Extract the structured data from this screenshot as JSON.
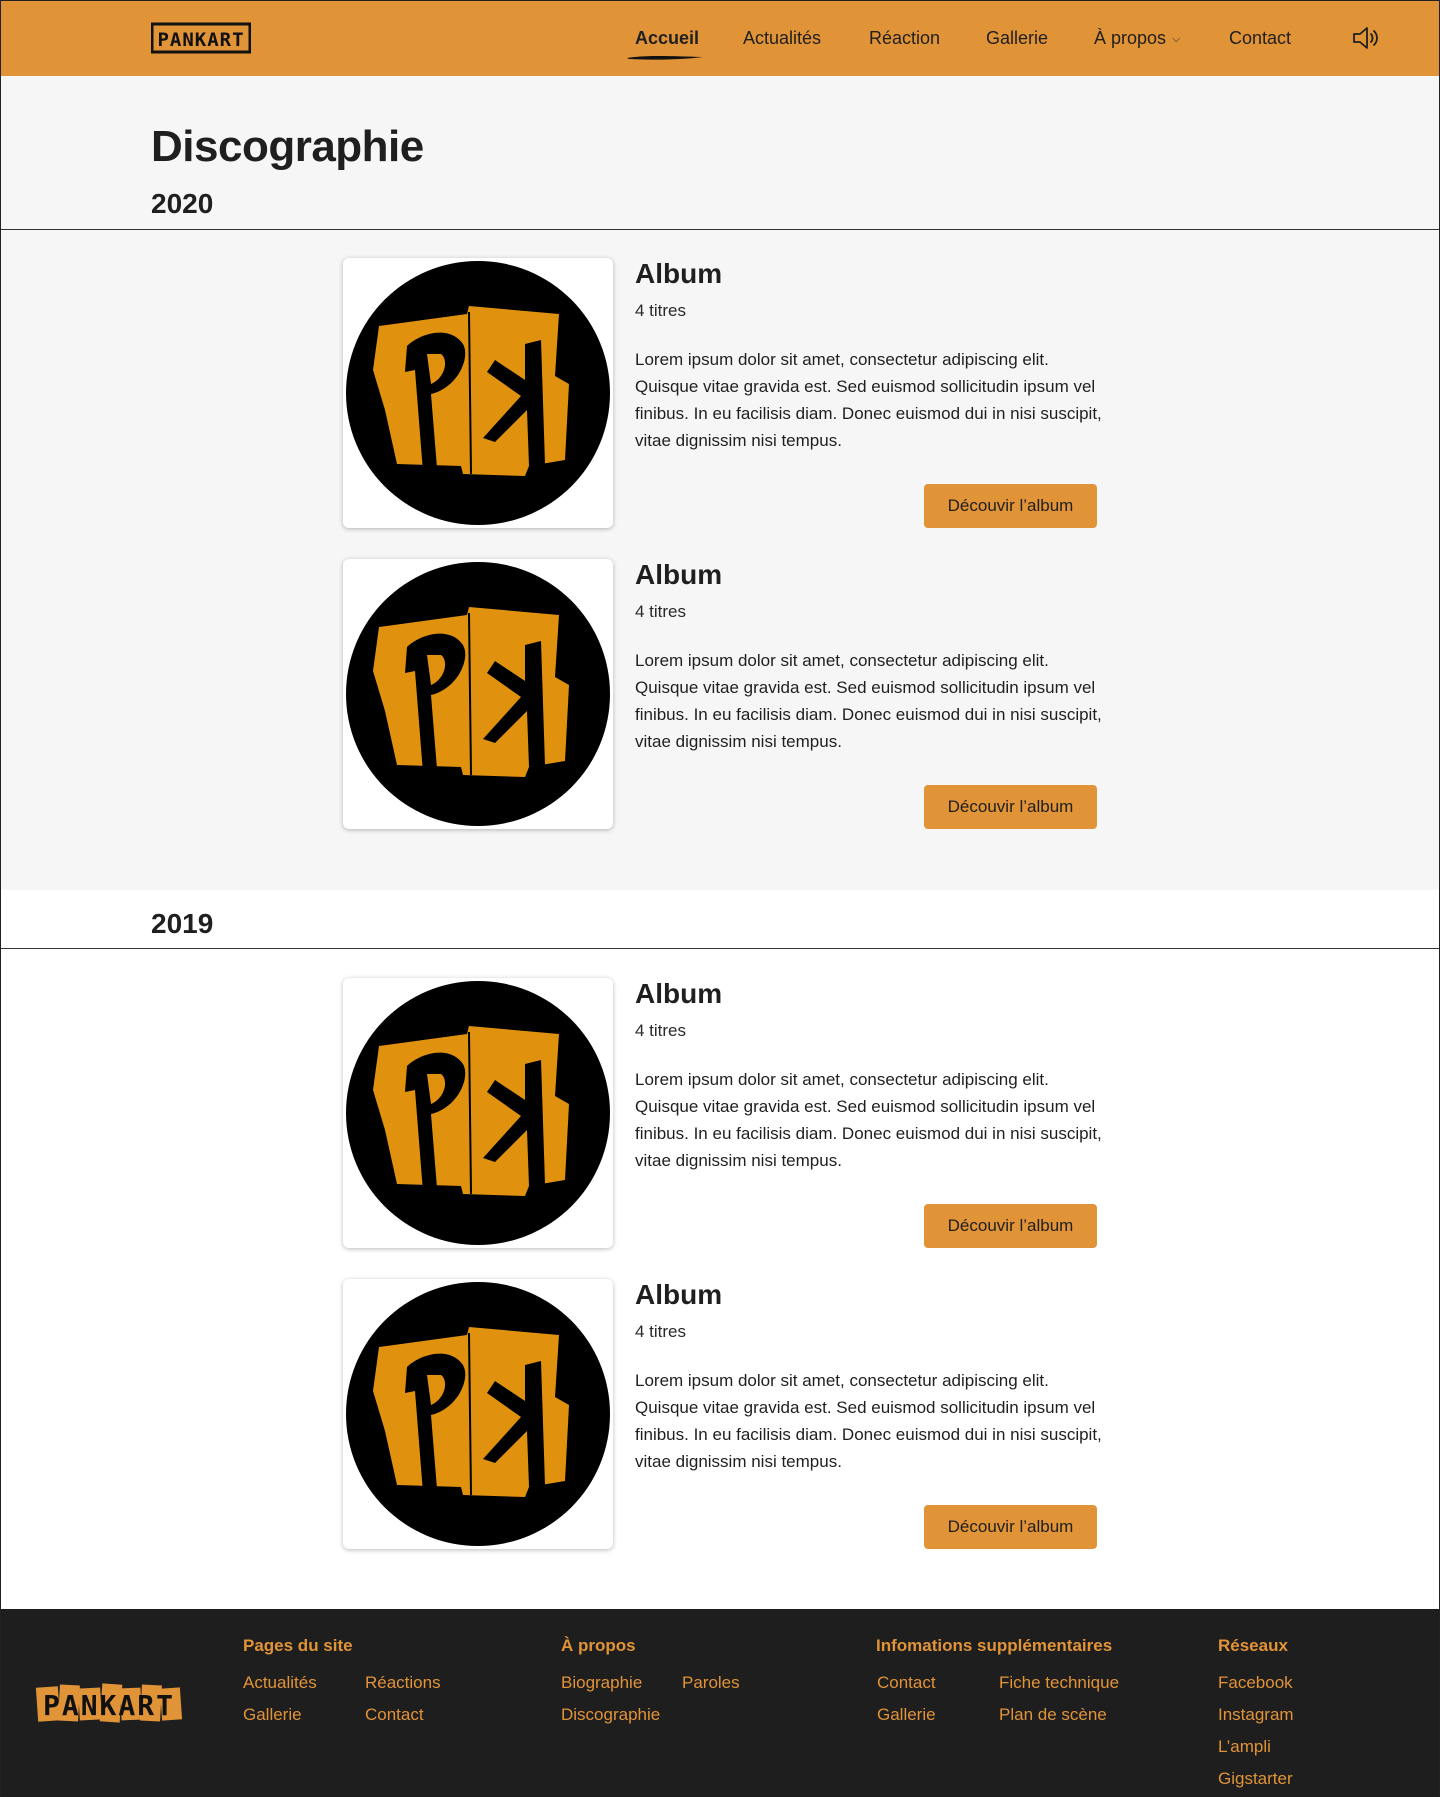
{
  "brand": {
    "logo_text": "PANKART",
    "accent_color": "#e19338",
    "dark_color": "#1e1e1e"
  },
  "nav": {
    "items": [
      {
        "label": "Accueil",
        "active": true
      },
      {
        "label": "Actualités"
      },
      {
        "label": "Réaction"
      },
      {
        "label": "Gallerie"
      },
      {
        "label": "À propos",
        "has_dropdown": true,
        "chevron": "⌵"
      },
      {
        "label": "Contact"
      }
    ],
    "sound_icon": "speaker-icon"
  },
  "page": {
    "title": "Discographie"
  },
  "sections": [
    {
      "year": "2020",
      "albums": [
        {
          "title": "Album",
          "count": "4 titres",
          "description": "Lorem ipsum dolor sit amet, consectetur adipiscing elit. Quisque vitae gravida est. Sed euismod sollicitudin ipsum vel finibus. In eu facilisis diam. Donec euismod dui in nisi suscipit, vitae dignissim nisi tempus.",
          "button": "Découvir l’album"
        },
        {
          "title": "Album",
          "count": "4 titres",
          "description": "Lorem ipsum dolor sit amet, consectetur adipiscing elit. Quisque vitae gravida est. Sed euismod sollicitudin ipsum vel finibus. In eu facilisis diam. Donec euismod dui in nisi suscipit, vitae dignissim nisi tempus.",
          "button": "Découvir l’album"
        }
      ]
    },
    {
      "year": "2019",
      "albums": [
        {
          "title": "Album",
          "count": "4 titres",
          "description": "Lorem ipsum dolor sit amet, consectetur adipiscing elit. Quisque vitae gravida est. Sed euismod sollicitudin ipsum vel finibus. In eu facilisis diam. Donec euismod dui in nisi suscipit, vitae dignissim nisi tempus.",
          "button": "Découvir l’album"
        },
        {
          "title": "Album",
          "count": "4 titres",
          "description": "Lorem ipsum dolor sit amet, consectetur adipiscing elit. Quisque vitae gravida est. Sed euismod sollicitudin ipsum vel finibus. In eu facilisis diam. Donec euismod dui in nisi suscipit, vitae dignissim nisi tempus.",
          "button": "Découvir l’album"
        }
      ]
    }
  ],
  "footer": {
    "columns": [
      {
        "heading": "Pages du site",
        "links": [
          "Actualités",
          "Réactions",
          "Gallerie",
          "Contact"
        ]
      },
      {
        "heading": "À propos",
        "links": [
          "Biographie",
          "Paroles",
          "Discographie"
        ]
      },
      {
        "heading": "Infomations supplémentaires",
        "links": [
          "Contact",
          "Fiche technique",
          "Gallerie",
          "Plan de scène"
        ]
      },
      {
        "heading": "Réseaux",
        "links": [
          "Facebook",
          "Instagram",
          "L’ampli",
          "Gigstarter"
        ]
      }
    ]
  }
}
